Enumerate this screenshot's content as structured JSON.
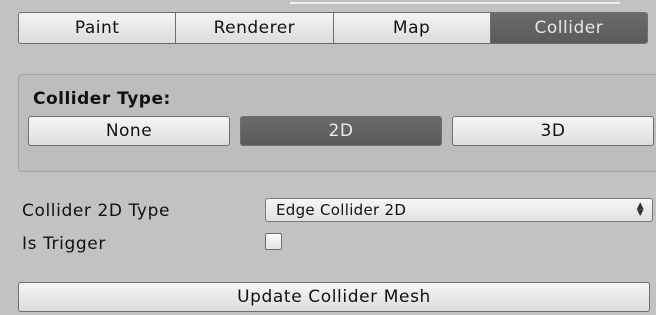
{
  "tabs": [
    {
      "label": "Paint",
      "active": false
    },
    {
      "label": "Renderer",
      "active": false
    },
    {
      "label": "Map",
      "active": false
    },
    {
      "label": "Collider",
      "active": true
    }
  ],
  "collider_type": {
    "title": "Collider Type:",
    "options": [
      {
        "label": "None",
        "active": false
      },
      {
        "label": "2D",
        "active": true
      },
      {
        "label": "3D",
        "active": false
      }
    ]
  },
  "properties": {
    "collider_2d_type_label": "Collider 2D Type",
    "collider_2d_type_value": "Edge Collider 2D",
    "is_trigger_label": "Is Trigger",
    "is_trigger_checked": false
  },
  "actions": {
    "update_label": "Update Collider Mesh"
  },
  "colors": {
    "background": "#c2c2c2",
    "active_button": "#5f5f5f",
    "active_text": "#e6e6e6"
  },
  "icons": {
    "dropdown": "up-down-arrows-icon"
  }
}
